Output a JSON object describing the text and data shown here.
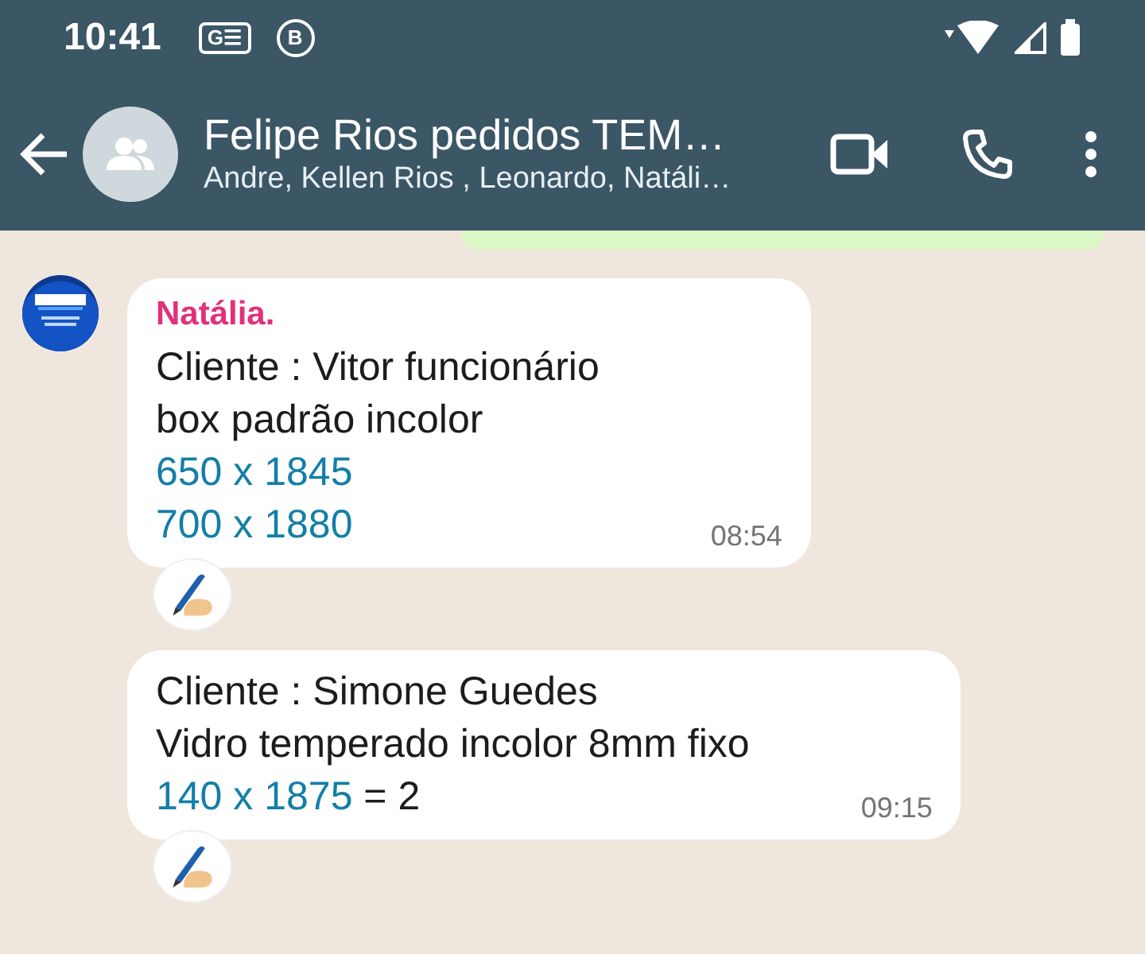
{
  "status_bar": {
    "time": "10:41",
    "badges": [
      "G☰",
      "B"
    ]
  },
  "header": {
    "title": "Felipe Rios pedidos TEM…",
    "subtitle": "Andre, Kellen Rios , Leonardo, Natáli…"
  },
  "messages": [
    {
      "sender": "Natália.",
      "show_avatar": true,
      "time": "08:54",
      "reaction": {
        "kind": "writing-hand"
      },
      "lines": [
        [
          {
            "kind": "text",
            "text": "Cliente : Vitor funcionário"
          }
        ],
        [
          {
            "kind": "text",
            "text": "box padrão incolor"
          }
        ],
        [
          {
            "kind": "number",
            "text": "650 x 1845"
          }
        ],
        [
          {
            "kind": "number",
            "text": "700 x 1880"
          }
        ]
      ]
    },
    {
      "show_avatar": false,
      "time": "09:15",
      "reaction": {
        "kind": "writing-hand"
      },
      "lines": [
        [
          {
            "kind": "text",
            "text": "Cliente : Simone Guedes"
          }
        ],
        [
          {
            "kind": "text",
            "text": "Vidro temperado incolor 8mm fixo"
          }
        ],
        [
          {
            "kind": "number",
            "text": "140 x 1875"
          },
          {
            "kind": "text",
            "text": " = 2"
          }
        ]
      ]
    }
  ]
}
